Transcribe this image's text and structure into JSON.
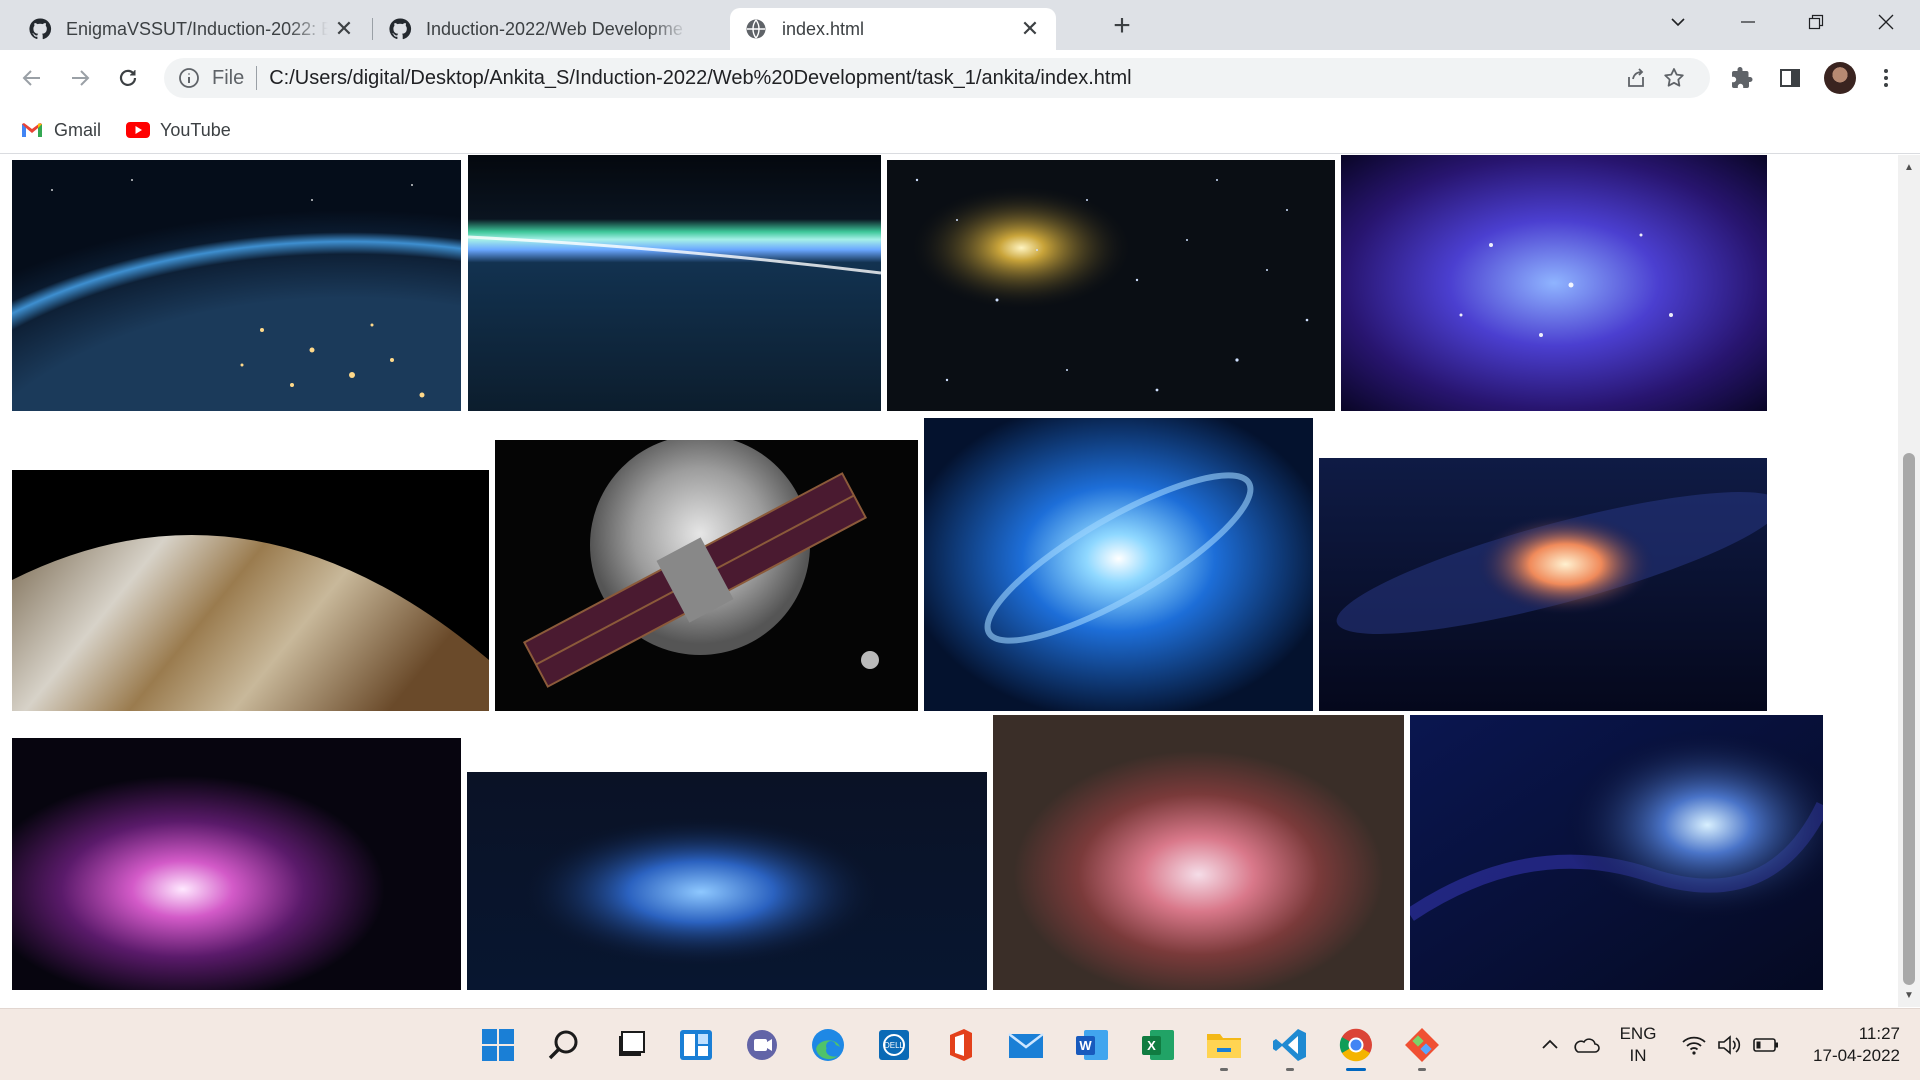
{
  "browser": {
    "tabs": [
      {
        "title": "EnigmaVSSUT/Induction-2022: En",
        "icon": "github-icon",
        "active": false
      },
      {
        "title": "Induction-2022/Web Developme",
        "icon": "github-icon",
        "active": false
      },
      {
        "title": "index.html",
        "icon": "globe-icon",
        "active": true
      }
    ],
    "address": {
      "scheme": "File",
      "url": "C:/Users/digital/Desktop/Ankita_S/Induction-2022/Web%20Development/task_1/ankita/index.html"
    },
    "bookmarks": [
      {
        "label": "Gmail",
        "icon": "gmail-icon"
      },
      {
        "label": "YouTube",
        "icon": "youtube-icon"
      }
    ]
  },
  "page": {
    "gallery": [
      {
        "name": "earth-night-city-lights",
        "alt": "Earth at night with city lights"
      },
      {
        "name": "earth-aurora-horizon",
        "alt": "Aurora over earth horizon"
      },
      {
        "name": "star-field-golden-star",
        "alt": "Star field with bright golden star"
      },
      {
        "name": "blue-purple-nebula",
        "alt": "Blue and purple nebula"
      },
      {
        "name": "jupiter-surface",
        "alt": "Jupiter cloud bands"
      },
      {
        "name": "solar-sail-moon",
        "alt": "Spacecraft with solar panels in front of the moon"
      },
      {
        "name": "blue-spiral-galaxy",
        "alt": "Bright blue spiral galaxy"
      },
      {
        "name": "milky-way-core",
        "alt": "Milky way core"
      },
      {
        "name": "orion-nebula",
        "alt": "Pink orion nebula"
      },
      {
        "name": "blue-gas-cloud",
        "alt": "Blue interstellar gas cloud"
      },
      {
        "name": "lagoon-nebula",
        "alt": "Red and pink lagoon nebula"
      },
      {
        "name": "dark-blue-nebula",
        "alt": "Dark blue cosmic clouds"
      }
    ]
  },
  "taskbar": {
    "apps": [
      "windows-start-icon",
      "search-icon",
      "task-view-icon",
      "widgets-icon",
      "teams-chat-icon",
      "edge-icon",
      "dell-icon",
      "office-icon",
      "mail-icon",
      "word-icon",
      "excel-icon",
      "file-explorer-icon",
      "vscode-icon",
      "chrome-icon",
      "git-icon"
    ],
    "language": {
      "line1": "ENG",
      "line2": "IN"
    },
    "time": "11:27",
    "date": "17-04-2022"
  },
  "colors": {
    "tabstrip": "#dee1e6",
    "omnibox": "#f1f3f4",
    "taskbar": "#f3e9e3",
    "accent": "#0067c0"
  }
}
